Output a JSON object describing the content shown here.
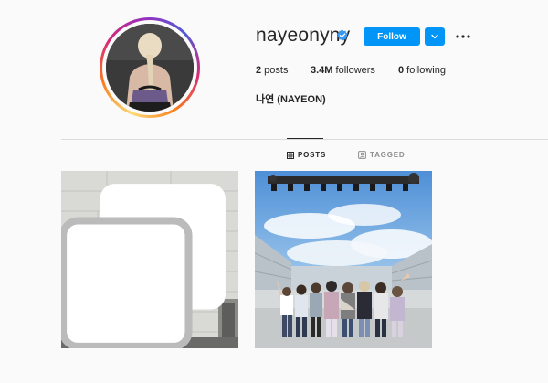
{
  "profile": {
    "username": "nayeonyny",
    "verified": true,
    "follow_label": "Follow",
    "full_name": "나연 (NAYEON)",
    "stats": {
      "posts_count": "2",
      "posts_label": " posts",
      "followers_count": "3.4M",
      "followers_label": " followers",
      "following_count": "0",
      "following_label": " following"
    }
  },
  "tabs": [
    {
      "label": "POSTS",
      "icon": "grid-icon",
      "active": true
    },
    {
      "label": "TAGGED",
      "icon": "tag-icon",
      "active": false
    }
  ],
  "colors": {
    "accent": "#0095f6",
    "background": "#fafafa",
    "text": "#262626",
    "muted": "#8e8e8e"
  },
  "posts": [
    {
      "id": 1,
      "multiple": true,
      "icon": "multi-image-icon"
    },
    {
      "id": 2,
      "multiple": false
    }
  ]
}
